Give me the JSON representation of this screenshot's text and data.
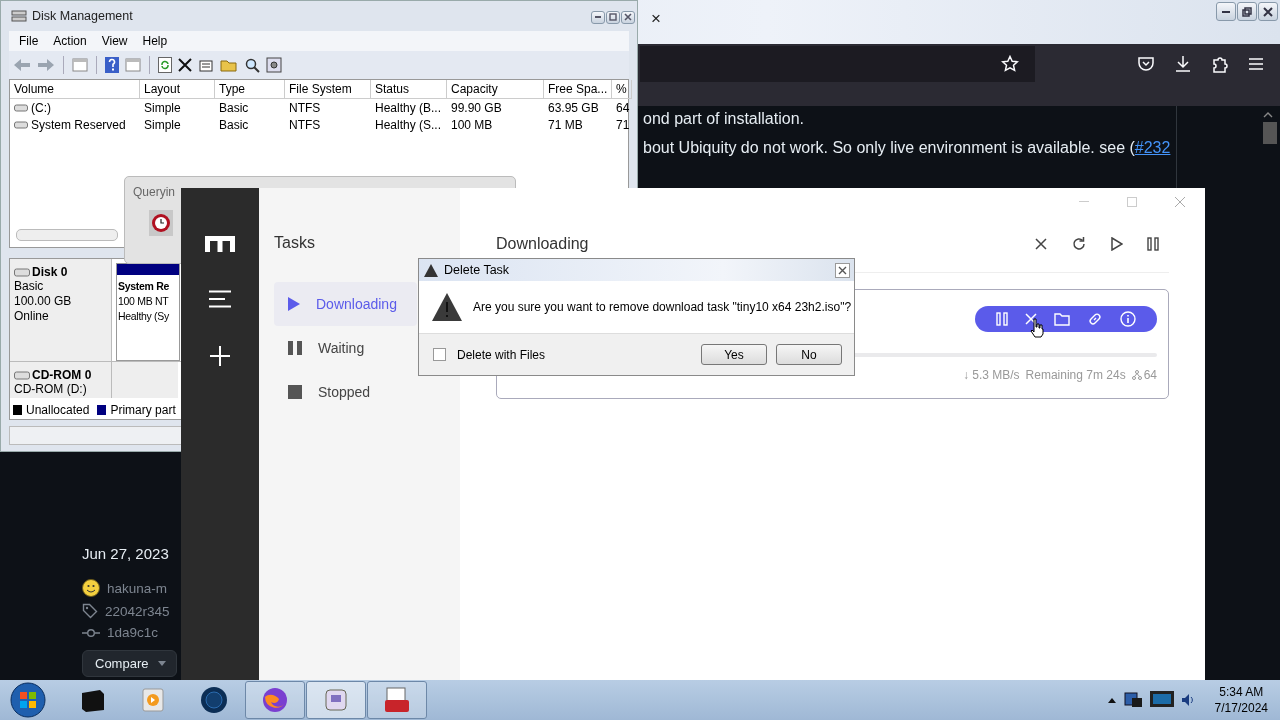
{
  "browser": {
    "tab_close": "×",
    "lines": [
      {
        "text": "ond part of installation."
      },
      {
        "text": "bout Ubiquity do not work. So only live environment is available. see (",
        "link": "#232"
      }
    ],
    "release": {
      "date": "Jun 27, 2023",
      "author": "hakuna-m",
      "tag": "22042r345",
      "commit": "1da9c1c",
      "compare_button": "Compare"
    }
  },
  "disk_management": {
    "title": "Disk Management",
    "menu": [
      "File",
      "Action",
      "View",
      "Help"
    ],
    "columns": [
      "Volume",
      "Layout",
      "Type",
      "File System",
      "Status",
      "Capacity",
      "Free Spa...",
      "%"
    ],
    "rows": [
      [
        "(C:)",
        "Simple",
        "Basic",
        "NTFS",
        "Healthy (B...",
        "99.90 GB",
        "63.95 GB",
        "64"
      ],
      [
        "System Reserved",
        "Simple",
        "Basic",
        "NTFS",
        "Healthy (S...",
        "100 MB",
        "71 MB",
        "71"
      ]
    ],
    "disks": [
      {
        "name": "Disk 0",
        "lines": [
          "Basic",
          "100.00 GB",
          "Online"
        ]
      },
      {
        "name": "CD-ROM 0",
        "lines": [
          "CD-ROM (D:)"
        ]
      }
    ],
    "partition": {
      "name": "System Re",
      "lines": [
        "100 MB NT",
        "Healthy (Sy"
      ]
    },
    "legend": [
      {
        "label": "Unallocated",
        "color": "#000000"
      },
      {
        "label": "Primary part",
        "color": "#000080"
      }
    ]
  },
  "querying_dialog": {
    "title": "Queryin"
  },
  "motrix": {
    "tasks_title": "Tasks",
    "task_lists": [
      {
        "label": "Downloading",
        "kind": "play",
        "selected": true
      },
      {
        "label": "Waiting",
        "kind": "pause",
        "selected": false
      },
      {
        "label": "Stopped",
        "kind": "stop",
        "selected": false
      }
    ],
    "header": "Downloading",
    "task": {
      "speed": "↓ 5.3 MB/s",
      "remaining": "Remaining 7m 24s",
      "connections": "64"
    }
  },
  "delete_dialog": {
    "title": "Delete Task",
    "message": "Are you sure you want to remove download task \"tiny10 x64 23h2.iso\"?",
    "checkbox": {
      "label": "Delete with Files",
      "checked": false
    },
    "buttons": [
      "Yes",
      "No"
    ]
  },
  "taskbar": {
    "time": "5:34 AM",
    "date": "7/17/2024"
  }
}
